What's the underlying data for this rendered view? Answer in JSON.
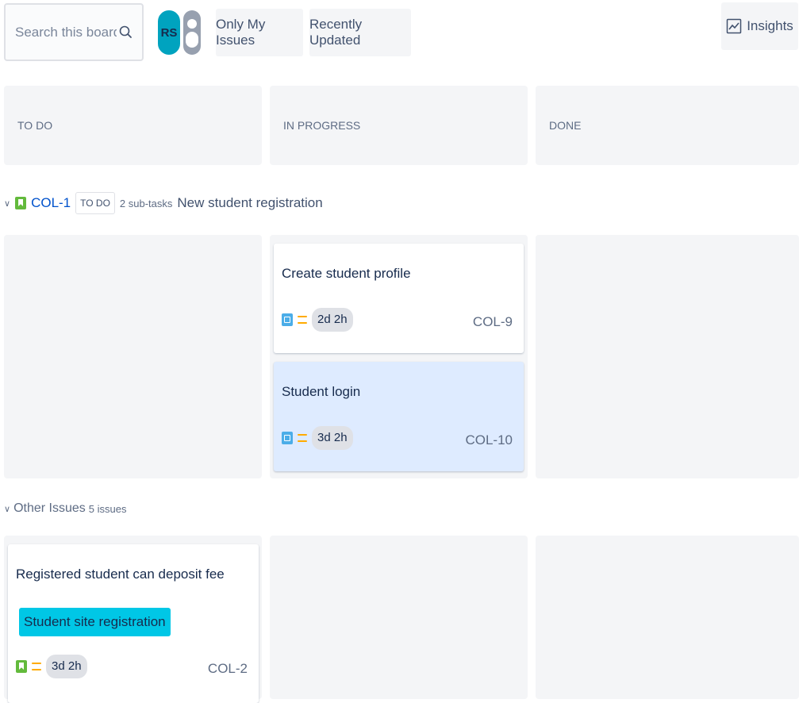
{
  "toolbar": {
    "search_placeholder": "Search this board",
    "avatar_initials": "RS",
    "quick_filters": [
      "Only My Issues",
      "Recently Updated"
    ],
    "insights_label": "Insights"
  },
  "columns": [
    "TO DO",
    "IN PROGRESS",
    "DONE"
  ],
  "swimlanes": [
    {
      "key": "COL-1",
      "status": "TO DO",
      "subtasks": "2 sub-tasks",
      "title": "New student registration",
      "cards": [
        {
          "title": "Create student profile",
          "estimate": "2d 2h",
          "key": "COL-9",
          "column": "IN PROGRESS"
        },
        {
          "title": "Student login",
          "estimate": "3d 2h",
          "key": "COL-10",
          "column": "IN PROGRESS",
          "selected": true
        }
      ]
    },
    {
      "title": "Other Issues",
      "count": "5 issues",
      "cards": [
        {
          "title": "Registered student can deposit fee",
          "epic": "Student site registration",
          "estimate": "3d 2h",
          "key": "COL-2",
          "column": "TO DO"
        }
      ]
    }
  ],
  "colors": {
    "epic": "#00c7e6",
    "story": "#63ba3c",
    "subtask": "#4bade8",
    "priority_medium": "#ffab00",
    "selected_card": "#deebff"
  }
}
